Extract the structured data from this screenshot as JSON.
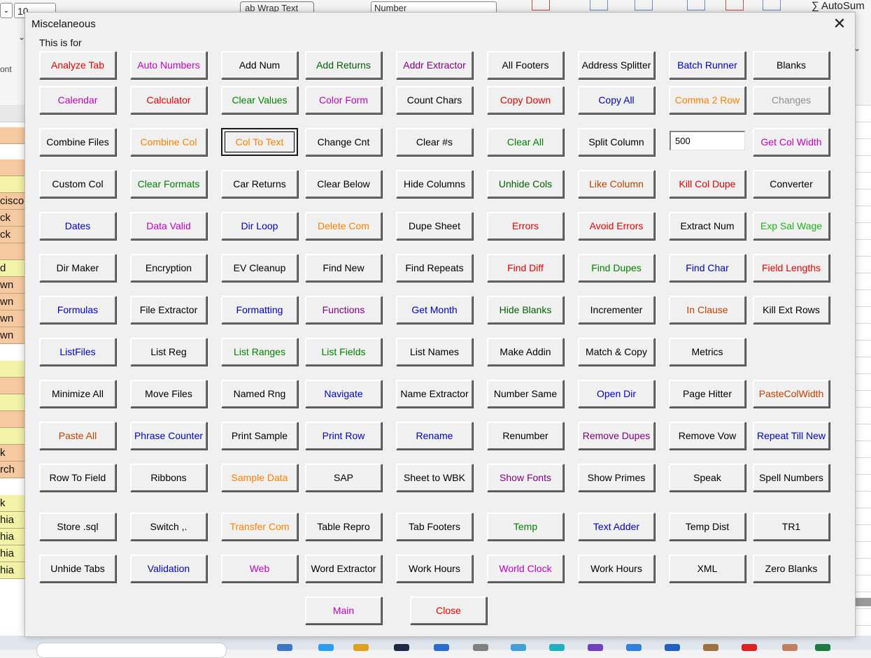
{
  "background": {
    "font_size_value": "10",
    "wrap_text_label": "ab Wrap Text",
    "number_format_value": "Number",
    "autosum_label": "∑ AutoSum",
    "font_group_label": "ont",
    "cells": [
      "cisco",
      "ck",
      "ck",
      "d",
      "wn",
      "wn",
      "wn",
      "wn",
      "k",
      "rch",
      "k",
      "hia",
      "hia",
      "hia",
      "hia"
    ]
  },
  "dialog": {
    "title": "Miscelaneous",
    "caption": "This is for",
    "width_input_value": "500"
  },
  "colors": {
    "black": "#000000",
    "red": "#e00000",
    "magenta": "#c000c0",
    "green": "#008000",
    "orange": "#ff8000",
    "blue": "#0000c0",
    "gray": "#909090",
    "brown": "#c04000",
    "purple": "#800080",
    "darkgreen": "#006000",
    "lime": "#20b020"
  },
  "rows": [
    [
      {
        "label": "Analyze Tab",
        "color": "red"
      },
      {
        "label": "Auto Numbers",
        "color": "magenta"
      },
      {
        "label": "Add Num",
        "color": "black"
      },
      {
        "label": "Add Returns",
        "color": "darkgreen"
      },
      {
        "label": "Addr Extractor",
        "color": "purple"
      },
      {
        "label": "All Footers",
        "color": "black"
      },
      {
        "label": "Address Splitter",
        "color": "black"
      },
      {
        "label": "Batch Runner",
        "color": "blue"
      },
      {
        "label": "Blanks",
        "color": "black"
      }
    ],
    [
      {
        "label": "Calendar",
        "color": "magenta"
      },
      {
        "label": "Calculator",
        "color": "red"
      },
      {
        "label": "Clear Values",
        "color": "green"
      },
      {
        "label": "Color Form",
        "color": "magenta"
      },
      {
        "label": "Count Chars",
        "color": "black"
      },
      {
        "label": "Copy Down",
        "color": "red"
      },
      {
        "label": "Copy All",
        "color": "blue"
      },
      {
        "label": "Comma 2 Row",
        "color": "orange"
      },
      {
        "label": "Changes",
        "color": "gray"
      }
    ],
    [
      {
        "label": "Combine Files",
        "color": "black"
      },
      {
        "label": "Combine Col",
        "color": "orange"
      },
      {
        "label": "Col To Text",
        "color": "orange",
        "focused": true
      },
      {
        "label": "Change Cnt",
        "color": "black"
      },
      {
        "label": "Clear #s",
        "color": "black"
      },
      {
        "label": "Clear All",
        "color": "green"
      },
      {
        "label": "Split Column",
        "color": "black"
      },
      {
        "input": true
      },
      {
        "label": "Get Col Width",
        "color": "magenta"
      }
    ],
    [
      {
        "label": "Custom Col",
        "color": "black"
      },
      {
        "label": "Clear Formats",
        "color": "green"
      },
      {
        "label": "Car Returns",
        "color": "black"
      },
      {
        "label": "Clear Below",
        "color": "black"
      },
      {
        "label": "Hide Columns",
        "color": "black"
      },
      {
        "label": "Unhide Cols",
        "color": "darkgreen"
      },
      {
        "label": "Like Column",
        "color": "brown"
      },
      {
        "label": "Kill Col Dupe",
        "color": "red"
      },
      {
        "label": "Converter",
        "color": "black"
      }
    ],
    [
      {
        "label": "Dates",
        "color": "blue"
      },
      {
        "label": "Data Valid",
        "color": "magenta"
      },
      {
        "label": "Dir Loop",
        "color": "blue"
      },
      {
        "label": "Delete Com",
        "color": "orange"
      },
      {
        "label": "Dupe Sheet",
        "color": "black"
      },
      {
        "label": "Errors",
        "color": "red"
      },
      {
        "label": "Avoid Errors",
        "color": "red"
      },
      {
        "label": "Extract Num",
        "color": "black"
      },
      {
        "label": "Exp Sal Wage",
        "color": "lime"
      }
    ],
    [
      {
        "label": "Dir Maker",
        "color": "black"
      },
      {
        "label": "Encryption",
        "color": "black"
      },
      {
        "label": "EV Cleanup",
        "color": "black"
      },
      {
        "label": "Find New",
        "color": "black"
      },
      {
        "label": "Find Repeats",
        "color": "black"
      },
      {
        "label": "Find Diff",
        "color": "red"
      },
      {
        "label": "Find Dupes",
        "color": "green"
      },
      {
        "label": "Find Char",
        "color": "blue"
      },
      {
        "label": "Field Lengths",
        "color": "red"
      }
    ],
    [
      {
        "label": "Formulas",
        "color": "blue"
      },
      {
        "label": "File Extractor",
        "color": "black"
      },
      {
        "label": "Formatting",
        "color": "blue"
      },
      {
        "label": "Functions",
        "color": "purple"
      },
      {
        "label": "Get Month",
        "color": "blue"
      },
      {
        "label": "Hide Blanks",
        "color": "darkgreen"
      },
      {
        "label": "Incrementer",
        "color": "black"
      },
      {
        "label": "In Clause",
        "color": "brown"
      },
      {
        "label": "Kill Ext Rows",
        "color": "black"
      }
    ],
    [
      {
        "label": "ListFiles",
        "color": "blue"
      },
      {
        "label": "List Reg",
        "color": "black"
      },
      {
        "label": "List Ranges",
        "color": "green"
      },
      {
        "label": "List Fields",
        "color": "green"
      },
      {
        "label": "List Names",
        "color": "black"
      },
      {
        "label": "Make Addin",
        "color": "black"
      },
      {
        "label": "Match & Copy",
        "color": "black"
      },
      {
        "label": "Metrics",
        "color": "black"
      }
    ],
    [
      {
        "label": "Minimize All",
        "color": "black"
      },
      {
        "label": "Move Files",
        "color": "black"
      },
      {
        "label": "Named Rng",
        "color": "black"
      },
      {
        "label": "Navigate",
        "color": "blue"
      },
      {
        "label": "Name Extractor",
        "color": "black"
      },
      {
        "label": "Number Same",
        "color": "black"
      },
      {
        "label": "Open Dir",
        "color": "blue"
      },
      {
        "label": "Page Hitter",
        "color": "black"
      },
      {
        "label": "PasteColWidth",
        "color": "brown"
      }
    ],
    [
      {
        "label": "Paste All",
        "color": "brown"
      },
      {
        "label": "Phrase Counter",
        "color": "blue"
      },
      {
        "label": "Print Sample",
        "color": "black"
      },
      {
        "label": "Print Row",
        "color": "blue"
      },
      {
        "label": "Rename",
        "color": "blue"
      },
      {
        "label": "Renumber",
        "color": "black"
      },
      {
        "label": "Remove Dupes",
        "color": "purple"
      },
      {
        "label": "Remove Vow",
        "color": "black"
      },
      {
        "label": "Repeat Till New",
        "color": "blue"
      }
    ],
    [
      {
        "label": "Row To Field",
        "color": "black"
      },
      {
        "label": "Ribbons",
        "color": "black"
      },
      {
        "label": "Sample Data",
        "color": "orange"
      },
      {
        "label": "SAP",
        "color": "black"
      },
      {
        "label": "Sheet to WBK",
        "color": "black"
      },
      {
        "label": "Show Fonts",
        "color": "purple"
      },
      {
        "label": "Show Primes",
        "color": "black"
      },
      {
        "label": "Speak",
        "color": "black"
      },
      {
        "label": "Spell Numbers",
        "color": "black"
      }
    ],
    [
      {
        "label": "Store .sql",
        "color": "black"
      },
      {
        "label": "Switch ,.",
        "color": "black"
      },
      {
        "label": "Transfer Com",
        "color": "orange"
      },
      {
        "label": "Table Repro",
        "color": "black"
      },
      {
        "label": "Tab Footers",
        "color": "black"
      },
      {
        "label": "Temp",
        "color": "green"
      },
      {
        "label": "Text Adder",
        "color": "blue"
      },
      {
        "label": "Temp Dist",
        "color": "black"
      },
      {
        "label": "TR1",
        "color": "black"
      }
    ],
    [
      {
        "label": "Unhide Tabs",
        "color": "black"
      },
      {
        "label": "Validation",
        "color": "blue"
      },
      {
        "label": "Web",
        "color": "magenta"
      },
      {
        "label": "Word Extractor",
        "color": "black"
      },
      {
        "label": "Work Hours",
        "color": "black"
      },
      {
        "label": "World Clock",
        "color": "magenta"
      },
      {
        "label": "Work Hours",
        "color": "black"
      },
      {
        "label": "XML",
        "color": "black"
      },
      {
        "label": "Zero Blanks",
        "color": "black"
      }
    ]
  ],
  "footer": [
    {
      "label": "Main",
      "color": "magenta"
    },
    {
      "label": "Close",
      "color": "red"
    }
  ]
}
